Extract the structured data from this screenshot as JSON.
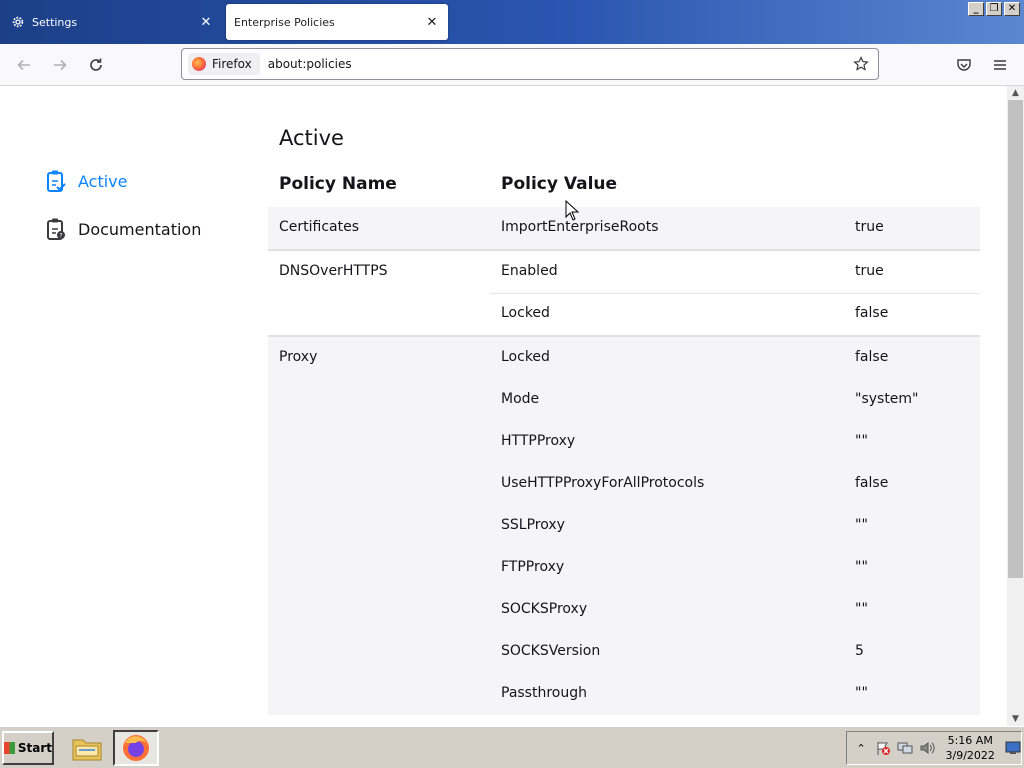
{
  "tabs": [
    {
      "label": "Settings",
      "active": false
    },
    {
      "label": "Enterprise Policies",
      "active": true
    }
  ],
  "navbar": {
    "identity_label": "Firefox",
    "url": "about:policies"
  },
  "sidebar": {
    "items": [
      {
        "label": "Active",
        "selected": true
      },
      {
        "label": "Documentation",
        "selected": false
      }
    ]
  },
  "main": {
    "title": "Active",
    "col_policy_name": "Policy Name",
    "col_policy_value": "Policy Value",
    "groups": [
      {
        "name": "Certificates",
        "rows": [
          {
            "key": "ImportEnterpriseRoots",
            "value": "true"
          }
        ]
      },
      {
        "name": "DNSOverHTTPS",
        "rows": [
          {
            "key": "Enabled",
            "value": "true"
          },
          {
            "key": "Locked",
            "value": "false"
          }
        ]
      },
      {
        "name": "Proxy",
        "rows": [
          {
            "key": "Locked",
            "value": "false"
          },
          {
            "key": "Mode",
            "value": "\"system\""
          },
          {
            "key": "HTTPProxy",
            "value": "\"\""
          },
          {
            "key": "UseHTTPProxyForAllProtocols",
            "value": "false"
          },
          {
            "key": "SSLProxy",
            "value": "\"\""
          },
          {
            "key": "FTPProxy",
            "value": "\"\""
          },
          {
            "key": "SOCKSProxy",
            "value": "\"\""
          },
          {
            "key": "SOCKSVersion",
            "value": "5"
          },
          {
            "key": "Passthrough",
            "value": "\"\""
          }
        ]
      }
    ]
  },
  "taskbar": {
    "start_label": "Start",
    "clock_time": "5:16 AM",
    "clock_date": "3/9/2022"
  },
  "colors": {
    "accent": "#0a84ff",
    "titlebar": "#2a55b0"
  }
}
